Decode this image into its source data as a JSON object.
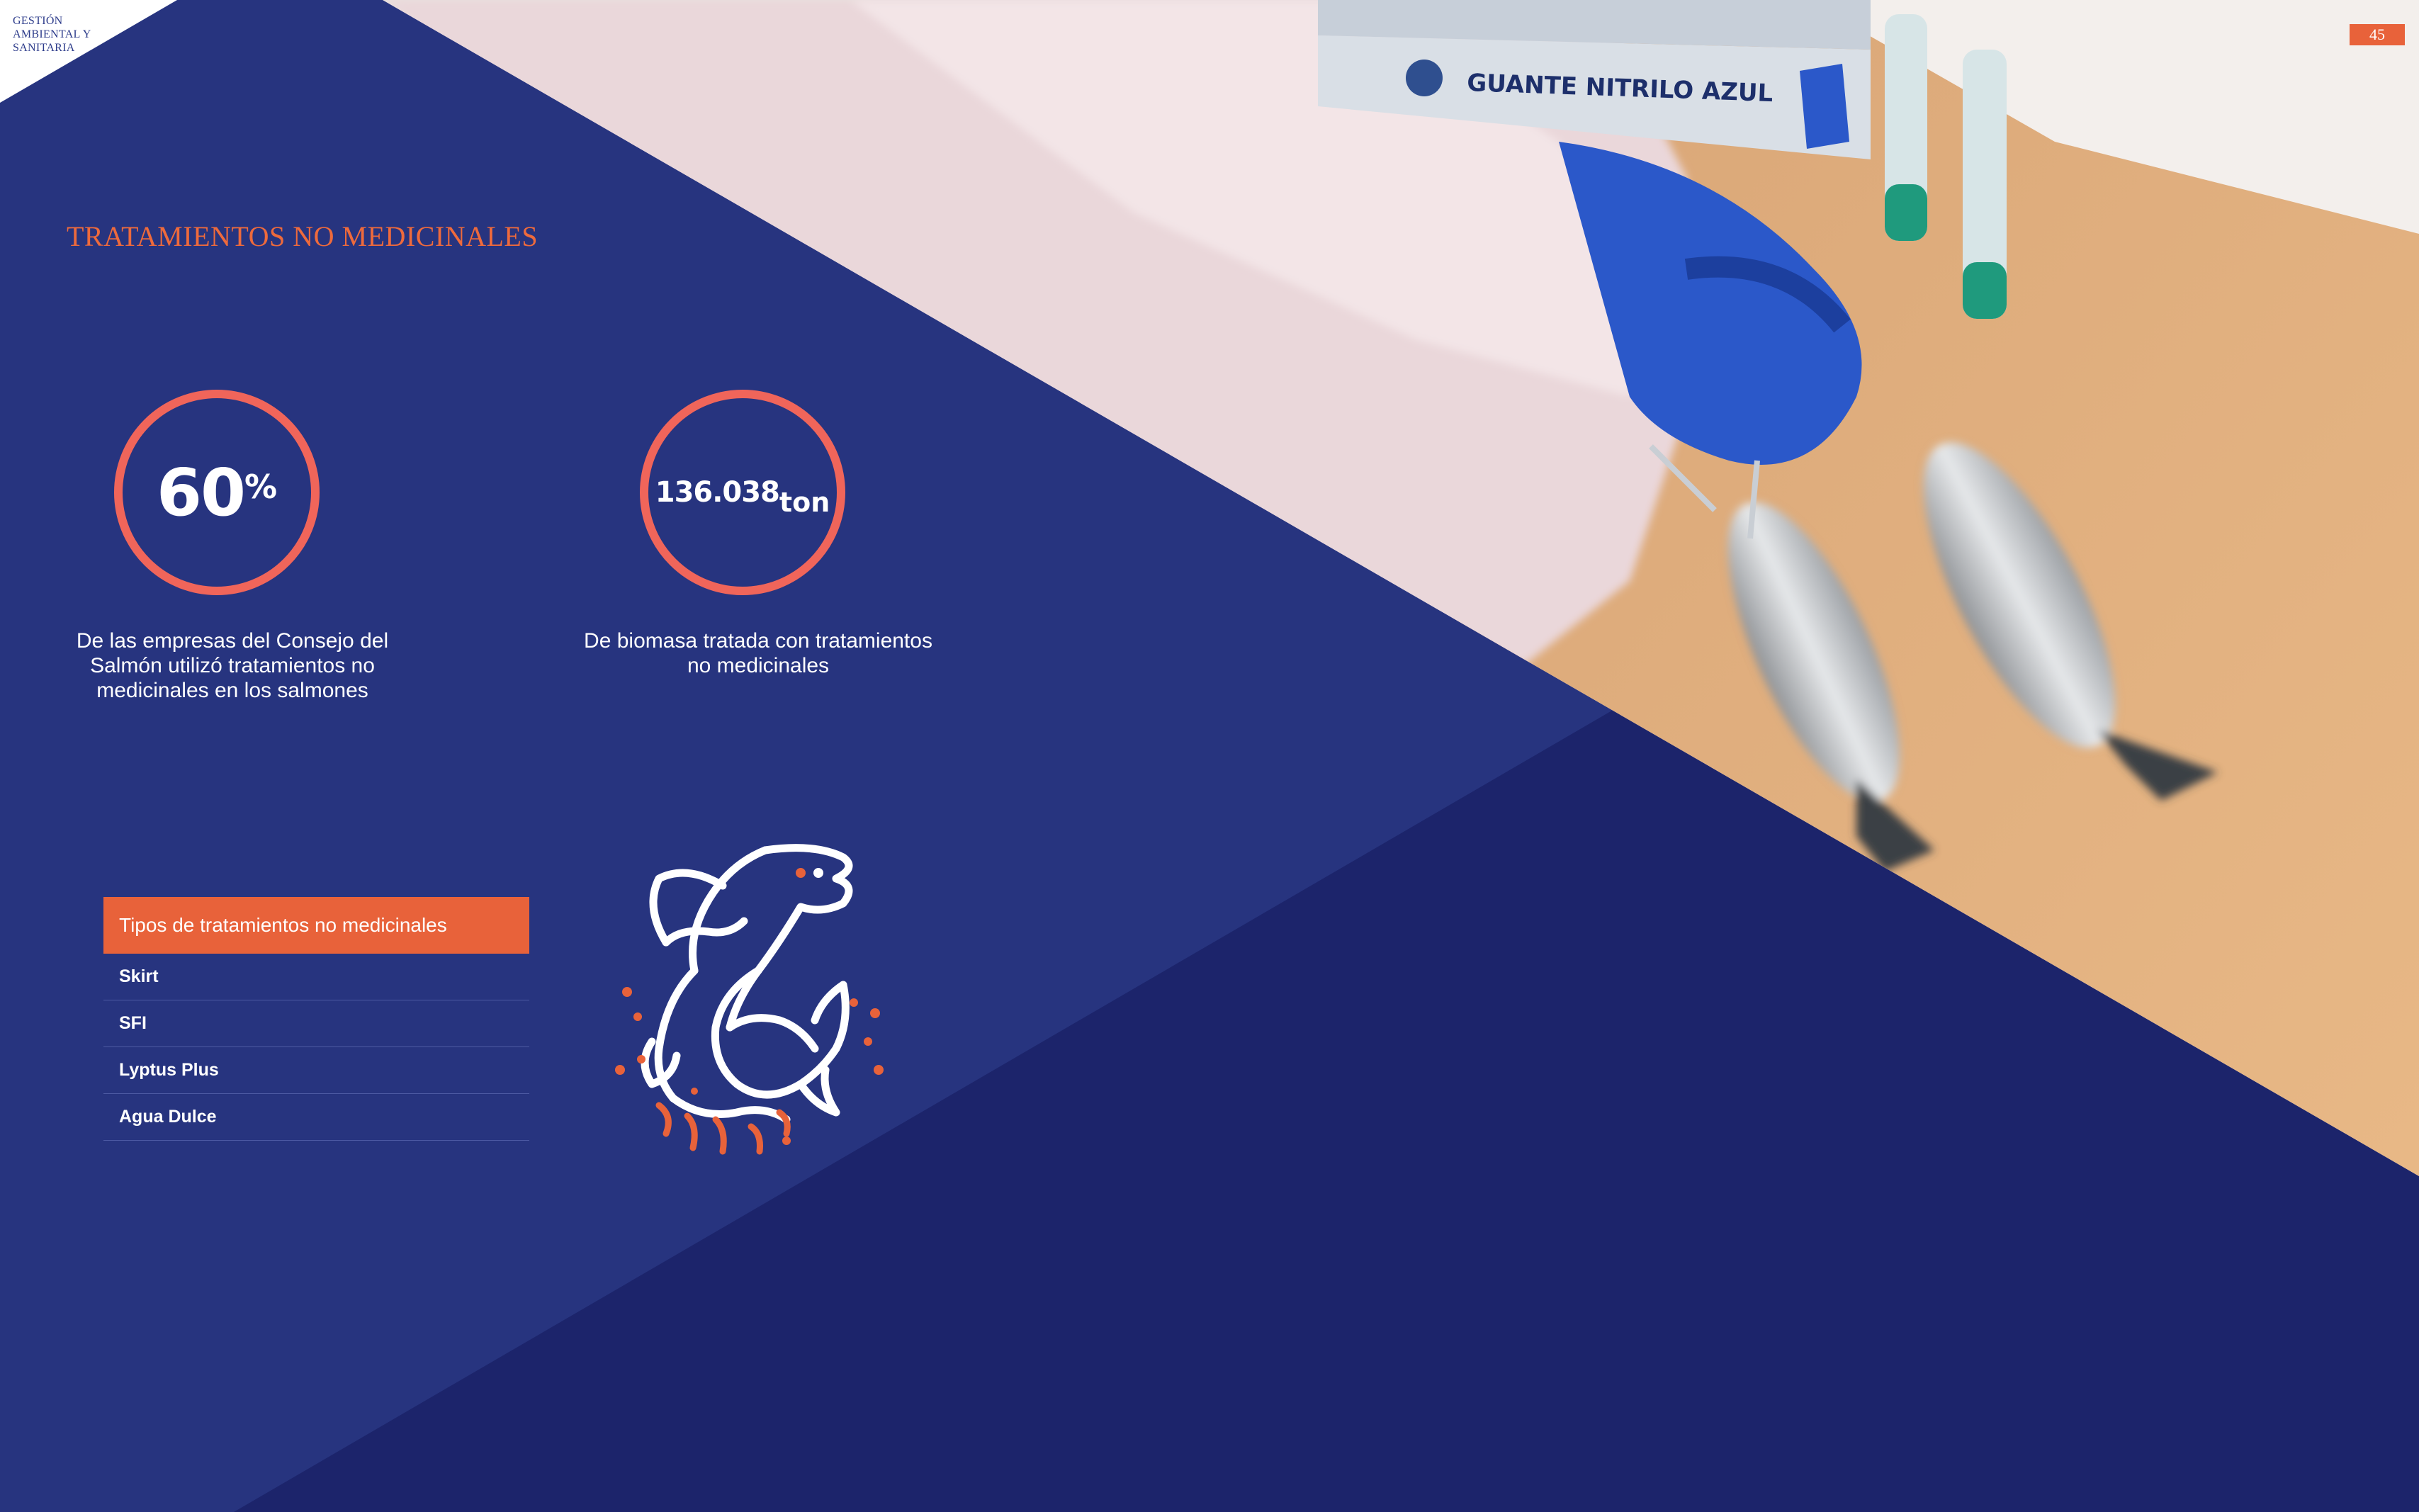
{
  "header": {
    "section_label_lines": [
      "GESTIÓN",
      "AMBIENTAL Y",
      "SANITARIA"
    ],
    "page_number": "45"
  },
  "title": "TRATAMIENTOS NO MEDICINALES",
  "stats": [
    {
      "value": "60",
      "unit": "%",
      "description": "De las empresas del Consejo del Salmón utilizó tratamientos no medicinales en los salmones"
    },
    {
      "value": "136.038",
      "unit": "ton",
      "description": "De biomasa tratada con tratamientos no medicinales"
    }
  ],
  "treatments": {
    "header": "Tipos de tratamientos no medicinales",
    "items": [
      "Skirt",
      "SFI",
      "Lyptus Plus",
      "Agua Dulce"
    ]
  },
  "photo": {
    "glove_box_text": "GUANTE NITRILO AZUL"
  },
  "icons": {
    "fish": "salmon-jumping-icon"
  },
  "colors": {
    "navy": "#27347f",
    "navy_dark": "#1c246b",
    "accent": "#e8623a",
    "ring": "#f0655a"
  }
}
